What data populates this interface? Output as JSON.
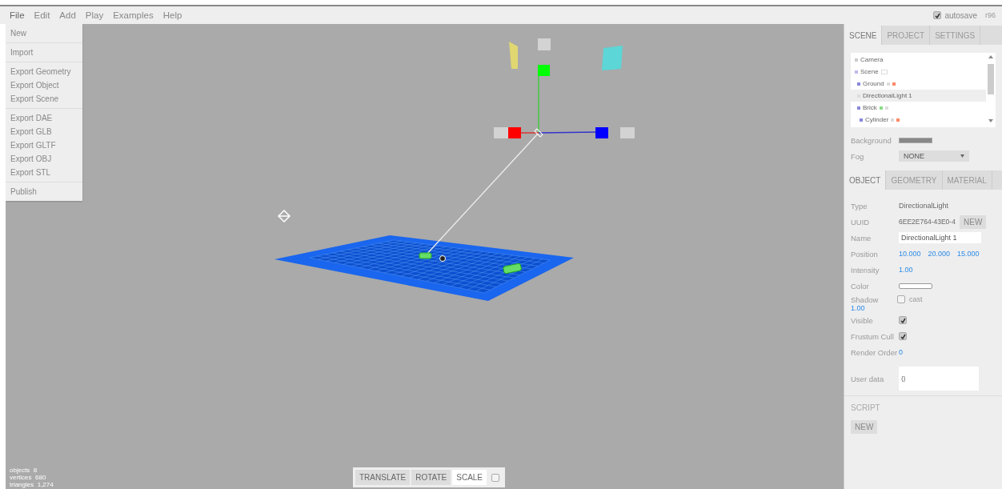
{
  "menubar": {
    "menus": [
      {
        "label": "File",
        "selected": true
      },
      {
        "label": "Edit",
        "selected": false
      },
      {
        "label": "Add",
        "selected": false
      },
      {
        "label": "Play",
        "selected": false
      },
      {
        "label": "Examples",
        "selected": false
      },
      {
        "label": "Help",
        "selected": false
      }
    ],
    "autosave": {
      "label": "autosave",
      "checked": true
    },
    "version": "r96"
  },
  "file_menu": {
    "groups": [
      [
        "New"
      ],
      [
        "Import"
      ],
      [
        "Export Geometry",
        "Export Object",
        "Export Scene"
      ],
      [
        "Export DAE",
        "Export GLB",
        "Export GLTF",
        "Export OBJ",
        "Export STL"
      ],
      [
        "Publish"
      ]
    ]
  },
  "stats": [
    "objects  8",
    "vertices  680",
    "triangles  1,274"
  ],
  "toolbar": {
    "buttons": [
      {
        "label": "TRANSLATE",
        "selected": false
      },
      {
        "label": "ROTATE",
        "selected": false
      },
      {
        "label": "SCALE",
        "selected": true
      }
    ],
    "local_checked": false
  },
  "sidebar": {
    "tabs": [
      {
        "label": "SCENE",
        "selected": true
      },
      {
        "label": "PROJECT",
        "selected": false
      },
      {
        "label": "SETTINGS",
        "selected": false
      }
    ],
    "outliner": [
      {
        "label": "Camera",
        "color": "#cccccc",
        "selected": false
      },
      {
        "label": "Scene",
        "color": "#bbbbee",
        "selected": false,
        "expanded": true,
        "children": [
          {
            "label": "Ground",
            "color": "#8888dd",
            "selected": false,
            "badges": [
              {
                "color": "#dddddd"
              },
              {
                "color": "#ff8866"
              }
            ]
          },
          {
            "label": "DirectionalLight 1",
            "color": "#dddddd",
            "selected": true
          },
          {
            "label": "Brick",
            "color": "#8888dd",
            "selected": false,
            "badges": [
              {
                "color": "#88dd88"
              },
              {
                "color": "#dddddd"
              }
            ],
            "children": [
              {
                "label": "Cylinder",
                "color": "#8888dd",
                "selected": false,
                "badges": [
                  {
                    "color": "#dddddd"
                  },
                  {
                    "color": "#ff8866"
                  }
                ]
              }
            ]
          }
        ]
      }
    ],
    "background": {
      "label": "Background"
    },
    "fog": {
      "label": "Fog",
      "value": "NONE"
    },
    "object_tabs": [
      {
        "label": "OBJECT",
        "selected": true
      },
      {
        "label": "GEOMETRY",
        "selected": false
      },
      {
        "label": "MATERIAL",
        "selected": false
      }
    ],
    "properties": [
      {
        "kind": "text",
        "label": "Type",
        "value": "DirectionalLight"
      },
      {
        "kind": "uuid",
        "label": "UUID",
        "value": "6EE2E764-43E0-4",
        "button": "NEW"
      },
      {
        "kind": "input",
        "label": "Name",
        "value": "DirectionalLight 1"
      },
      {
        "kind": "numbers",
        "label": "Position",
        "values": [
          "10.000",
          "20.000",
          "15.000"
        ]
      },
      {
        "kind": "numbers",
        "label": "Intensity",
        "values": [
          "1.00"
        ]
      },
      {
        "kind": "color",
        "label": "Color"
      },
      {
        "kind": "shadow",
        "label": "Shadow",
        "sub": "1.00",
        "checkbox": "cast",
        "checked": false
      },
      {
        "kind": "check",
        "label": "Visible",
        "checked": true
      },
      {
        "kind": "check",
        "label": "Frustum Cull",
        "checked": true
      },
      {
        "kind": "numbers",
        "label": "Render Order",
        "values": [
          "0"
        ]
      },
      {
        "kind": "textarea",
        "label": "User data",
        "value": "{}"
      }
    ],
    "script": {
      "title": "SCRIPT",
      "button": "NEW"
    }
  }
}
